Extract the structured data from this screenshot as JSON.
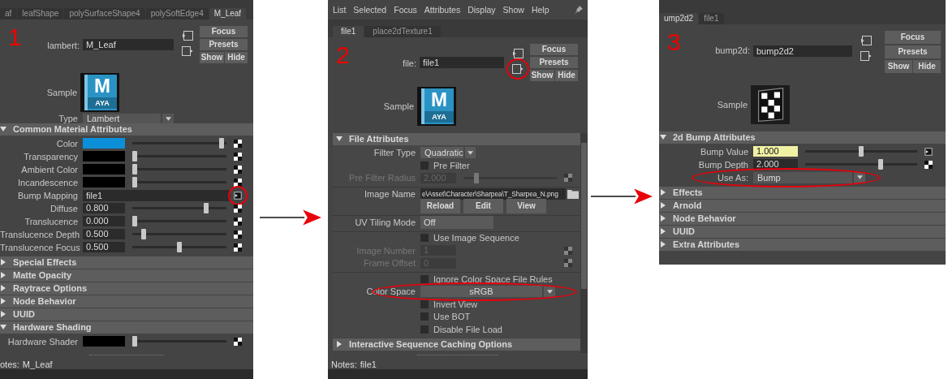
{
  "panels": [
    {
      "number": "1",
      "tabs": [
        {
          "label": "af",
          "selected": false
        },
        {
          "label": "leafShape",
          "selected": false
        },
        {
          "label": "polySurfaceShape4",
          "selected": false
        },
        {
          "label": "polySoftEdge4",
          "selected": false
        },
        {
          "label": "M_Leaf",
          "selected": true
        }
      ],
      "node_label": "lambert:",
      "node_name": "M_Leaf",
      "output_icon_circled": false,
      "buttons": [
        "Focus",
        "Presets",
        "Show",
        "Hide"
      ],
      "sample": {
        "label": "Sample",
        "kind": "logo",
        "logo_text": "M",
        "logo_subtext": "AYA"
      },
      "type_row": {
        "label": "Type",
        "value": "Lambert"
      },
      "scrollbar": false,
      "sections": [
        {
          "title": "Common Material Attributes",
          "expanded": true,
          "rows": [
            {
              "kind": "color",
              "label": "Color",
              "color": "#0b8fd8",
              "level": 0.97,
              "connected": false
            },
            {
              "kind": "color",
              "label": "Transparency",
              "color": "#000000",
              "level": 0,
              "connected": false
            },
            {
              "kind": "color",
              "label": "Ambient Color",
              "color": "#000000",
              "level": 0,
              "connected": false
            },
            {
              "kind": "color",
              "label": "Incandescence",
              "color": "#000000",
              "level": 0,
              "connected": false
            },
            {
              "kind": "link",
              "label": "Bump Mapping",
              "value": "file1",
              "connected": true,
              "circled": true
            },
            {
              "kind": "number",
              "label": "Diffuse",
              "value": "0.800",
              "level": 0.8,
              "connected": false,
              "disabled": false,
              "highlighted": false
            },
            {
              "kind": "number",
              "label": "Translucence",
              "value": "0.000",
              "level": 0,
              "connected": false,
              "disabled": false,
              "highlighted": false
            },
            {
              "kind": "number",
              "label": "Translucence Depth",
              "value": "0.500",
              "level": 0.1,
              "connected": false,
              "disabled": false,
              "highlighted": false
            },
            {
              "kind": "number",
              "label": "Translucence Focus",
              "value": "0.500",
              "level": 0.5,
              "connected": false,
              "disabled": false,
              "highlighted": false
            }
          ]
        },
        {
          "title": "Special Effects",
          "expanded": false
        },
        {
          "title": "Matte Opacity",
          "expanded": false
        },
        {
          "title": "Raytrace Options",
          "expanded": false
        },
        {
          "title": "Node Behavior",
          "expanded": false
        },
        {
          "title": "UUID",
          "expanded": false
        },
        {
          "title": "Hardware Shading",
          "expanded": true,
          "rows": [
            {
              "kind": "color",
              "label": "Hardware Shader",
              "color": "#000000",
              "level": 0,
              "connected": false
            }
          ]
        }
      ],
      "notes_label": "otes:",
      "notes": "M_Leaf"
    },
    {
      "number": "2",
      "menu": [
        "List",
        "Selected",
        "Focus",
        "Attributes",
        "Display",
        "Show",
        "Help"
      ],
      "tabs": [
        {
          "label": "file1",
          "selected": true
        },
        {
          "label": "place2dTexture1",
          "selected": false
        }
      ],
      "node_label": "file:",
      "node_name": "file1",
      "output_icon_circled": true,
      "buttons": [
        "Focus",
        "Presets",
        "Show",
        "Hide"
      ],
      "sample": {
        "label": "Sample",
        "kind": "logo",
        "logo_text": "M",
        "logo_subtext": "AYA"
      },
      "scrollbar": true,
      "sections": [
        {
          "title": "File Attributes",
          "expanded": true,
          "rows": [
            {
              "kind": "dropdown-short",
              "label": "Filter Type",
              "value": "Quadratic",
              "divider_before": false
            },
            {
              "kind": "checkbox",
              "text": "Pre Filter",
              "checked": false,
              "divider_before": false
            },
            {
              "kind": "number",
              "label": "Pre Filter Radius",
              "value": "2.000",
              "level": 0.12,
              "connected": false,
              "disabled": true,
              "highlighted": false,
              "divider_before": false
            },
            {
              "kind": "path",
              "label": "Image Name",
              "value": "e\\Asset\\Character\\Sharpea\\T_Sharpea_N.png",
              "divider_before": true
            },
            {
              "kind": "buttons",
              "buttons": [
                "Reload",
                "Edit",
                "View"
              ],
              "divider_before": false
            },
            {
              "kind": "field",
              "label": "UV Tiling Mode",
              "value": "Off",
              "divider_before": true
            },
            {
              "kind": "checkbox",
              "text": "Use Image Sequence",
              "checked": false,
              "divider_before": true
            },
            {
              "kind": "number",
              "label": "Image Number",
              "value": "1",
              "connected": false,
              "disabled": true,
              "highlighted": false,
              "divider_before": false
            },
            {
              "kind": "number",
              "label": "Frame Offset",
              "value": "0",
              "connected": false,
              "disabled": true,
              "highlighted": false,
              "divider_before": false
            },
            {
              "kind": "checkbox",
              "text": "Ignore Color Space File Rules",
              "checked": false,
              "divider_before": true
            },
            {
              "kind": "dropdown-centered",
              "label": "Color Space",
              "value": "sRGB",
              "circled": true,
              "divider_before": false
            },
            {
              "kind": "checkbox",
              "text": "Invert View",
              "checked": false,
              "divider_before": false
            },
            {
              "kind": "checkbox",
              "text": "Use BOT",
              "checked": false,
              "divider_before": false
            },
            {
              "kind": "checkbox",
              "text": "Disable File Load",
              "checked": false,
              "divider_before": false
            }
          ]
        },
        {
          "title": "Interactive Sequence Caching Options",
          "expanded": false
        }
      ],
      "notes_label": "Notes:",
      "notes": "file1"
    },
    {
      "number": "3",
      "tabs": [
        {
          "label": "ump2d2",
          "selected": true
        },
        {
          "label": "file1",
          "selected": false
        }
      ],
      "node_label": "bump2d:",
      "node_name": "bump2d2",
      "output_icon_circled": false,
      "buttons": [
        "Focus",
        "Presets",
        "Show",
        "Hide"
      ],
      "sample": {
        "label": "Sample",
        "kind": "checker"
      },
      "scrollbar": false,
      "sections": [
        {
          "title": "2d Bump Attributes",
          "expanded": true,
          "rows": [
            {
              "kind": "number",
              "label": "Bump Value",
              "value": "1.000",
              "level": 0.5,
              "connected": true,
              "disabled": false,
              "highlighted": true
            },
            {
              "kind": "number",
              "label": "Bump Depth",
              "value": "2.000",
              "level": 0.68,
              "connected": false,
              "disabled": false,
              "highlighted": false
            },
            {
              "kind": "dropdown",
              "label": "Use As:",
              "value": "Bump",
              "circled": true
            }
          ]
        },
        {
          "title": "Effects",
          "expanded": false
        },
        {
          "title": "Arnold",
          "expanded": false
        },
        {
          "title": "Node Behavior",
          "expanded": false
        },
        {
          "title": "UUID",
          "expanded": false
        },
        {
          "title": "Extra Attributes",
          "expanded": false
        }
      ]
    }
  ]
}
